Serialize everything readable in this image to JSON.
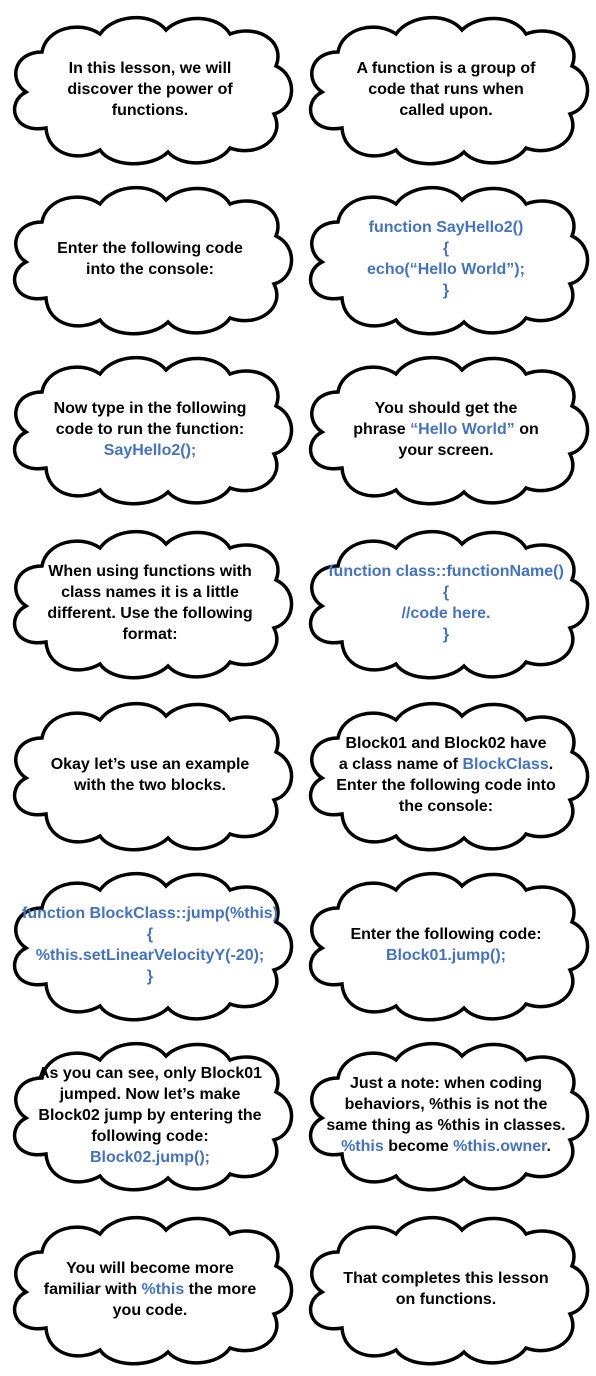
{
  "colors": {
    "code": "#4472c4",
    "text": "#000000",
    "cloud_fill": "#ffffff",
    "cloud_stroke": "#000000"
  },
  "clouds": [
    {
      "lines": [
        [
          {
            "t": "In this lesson, we will"
          }
        ],
        [
          {
            "t": "discover the power of"
          }
        ],
        [
          {
            "t": "functions."
          }
        ]
      ]
    },
    {
      "lines": [
        [
          {
            "t": "A function is a group of"
          }
        ],
        [
          {
            "t": "code that runs when"
          }
        ],
        [
          {
            "t": "called upon."
          }
        ]
      ]
    },
    {
      "lines": [
        [
          {
            "t": "Enter the following code"
          }
        ],
        [
          {
            "t": "into the console:"
          }
        ]
      ]
    },
    {
      "lines": [
        [
          {
            "t": "function SayHello2()",
            "b": true
          }
        ],
        [
          {
            "t": "{",
            "b": true
          }
        ],
        [
          {
            "t": "echo(“Hello World”);",
            "b": true
          }
        ],
        [
          {
            "t": "}",
            "b": true
          }
        ]
      ]
    },
    {
      "lines": [
        [
          {
            "t": "Now type in the following"
          }
        ],
        [
          {
            "t": "code to run the function:"
          }
        ],
        [
          {
            "t": "SayHello2();",
            "b": true
          }
        ]
      ]
    },
    {
      "lines": [
        [
          {
            "t": "You should get the"
          }
        ],
        [
          {
            "t": "phrase "
          },
          {
            "t": "“Hello World”",
            "b": true
          },
          {
            "t": " on"
          }
        ],
        [
          {
            "t": "your screen."
          }
        ]
      ]
    },
    {
      "lines": [
        [
          {
            "t": "When using functions with"
          }
        ],
        [
          {
            "t": "class names it is a little"
          }
        ],
        [
          {
            "t": "different. Use the following"
          }
        ],
        [
          {
            "t": "format:"
          }
        ]
      ]
    },
    {
      "lines": [
        [
          {
            "t": "function class::functionName()",
            "b": true
          }
        ],
        [
          {
            "t": "{",
            "b": true
          }
        ],
        [
          {
            "t": "//code here.",
            "b": true
          }
        ],
        [
          {
            "t": "}",
            "b": true
          }
        ]
      ]
    },
    {
      "lines": [
        [
          {
            "t": "Okay let’s use an example"
          }
        ],
        [
          {
            "t": "with the two blocks."
          }
        ]
      ]
    },
    {
      "lines": [
        [
          {
            "t": "Block01 and Block02 have"
          }
        ],
        [
          {
            "t": "a class name of "
          },
          {
            "t": "BlockClass",
            "b": true
          },
          {
            "t": "."
          }
        ],
        [
          {
            "t": "Enter the following code into"
          }
        ],
        [
          {
            "t": "the console:"
          }
        ]
      ]
    },
    {
      "lines": [
        [
          {
            "t": "function BlockClass::jump(%this)",
            "b": true
          }
        ],
        [
          {
            "t": "{",
            "b": true
          }
        ],
        [
          {
            "t": "%this.setLinearVelocityY(-20);",
            "b": true
          }
        ],
        [
          {
            "t": "}",
            "b": true
          }
        ]
      ]
    },
    {
      "lines": [
        [
          {
            "t": "Enter the following code:"
          }
        ],
        [
          {
            "t": "Block01.jump();",
            "b": true
          }
        ]
      ]
    },
    {
      "lines": [
        [
          {
            "t": "As you can see, only Block01"
          }
        ],
        [
          {
            "t": "jumped. Now let’s make"
          }
        ],
        [
          {
            "t": "Block02 jump by entering the"
          }
        ],
        [
          {
            "t": "following code:"
          }
        ],
        [
          {
            "t": "Block02.jump();",
            "b": true
          }
        ]
      ]
    },
    {
      "lines": [
        [
          {
            "t": "Just a note: when coding"
          }
        ],
        [
          {
            "t": "behaviors, %this is not the"
          }
        ],
        [
          {
            "t": "same thing as %this in classes."
          }
        ],
        [
          {
            "t": "%this",
            "b": true
          },
          {
            "t": " become "
          },
          {
            "t": "%this.owner",
            "b": true
          },
          {
            "t": "."
          }
        ]
      ]
    },
    {
      "lines": [
        [
          {
            "t": "You will become more"
          }
        ],
        [
          {
            "t": "familiar with "
          },
          {
            "t": "%this",
            "b": true
          },
          {
            "t": " the more"
          }
        ],
        [
          {
            "t": "you code."
          }
        ]
      ]
    },
    {
      "lines": [
        [
          {
            "t": "That completes this lesson"
          }
        ],
        [
          {
            "t": "on functions."
          }
        ]
      ]
    }
  ]
}
